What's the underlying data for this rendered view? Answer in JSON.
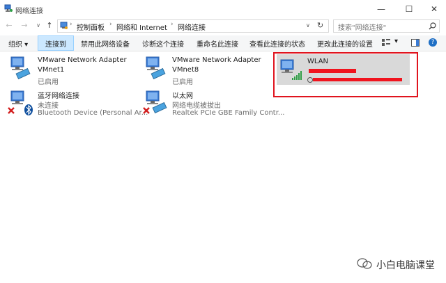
{
  "window": {
    "title": "网络连接",
    "controls": [
      "—",
      "☐",
      "✕"
    ]
  },
  "nav": {
    "back": "←",
    "forward": "→",
    "recent": "∨",
    "up": "↑"
  },
  "address": {
    "breadcrumb": [
      "控制面板",
      "网络和 Internet",
      "网络连接"
    ],
    "dropdown": "∨",
    "refresh": "↻"
  },
  "search": {
    "placeholder": "搜索\"网络连接\"",
    "icon": "search-icon"
  },
  "toolbar": {
    "organize": "组织 ▾",
    "connect": "连接到",
    "disable": "禁用此网络设备",
    "diagnose": "诊断这个连接",
    "rename": "重命名此连接",
    "status": "查看此连接的状态",
    "change": "更改此连接的设置",
    "view_dropdown": "▾",
    "help": "?"
  },
  "connections": [
    {
      "name": "VMware Network Adapter",
      "line2": "VMnet1",
      "line3": "已启用"
    },
    {
      "name": "VMware Network Adapter",
      "line2": "VMnet8",
      "line3": "已启用"
    },
    {
      "name": "WLAN",
      "line2": "",
      "line3": ""
    },
    {
      "name": "蓝牙网络连接",
      "line2": "未连接",
      "line3": "Bluetooth Device (Personal Ar..."
    },
    {
      "name": "以太网",
      "line2": "网络电缆被拔出",
      "line3": "Realtek PCIe GBE Family Contr..."
    }
  ],
  "watermark": "小白电脑课堂",
  "colors": {
    "accent": "#cce8ff",
    "highlight_frame": "#e0141e",
    "selection": "#d9d9d9"
  }
}
